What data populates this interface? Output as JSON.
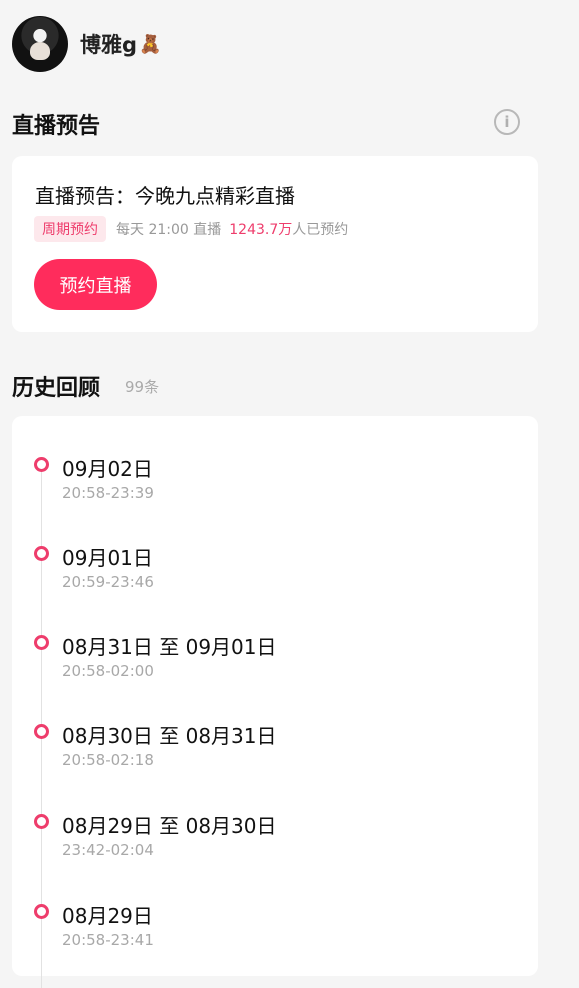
{
  "profile": {
    "username": "博雅g",
    "badge_emoji": "🧸"
  },
  "preview_section": {
    "title": "直播预告",
    "info_icon": "info-icon",
    "card": {
      "title": "直播预告：今晚九点精彩直播",
      "tag": "周期预约",
      "schedule": "每天 21:00 直播",
      "count": "1243.7万",
      "count_suffix": "人已预约",
      "button_label": "预约直播"
    }
  },
  "history_section": {
    "title": "历史回顾",
    "count_label": "99条",
    "items": [
      {
        "date": "09月02日",
        "time": "20:58-23:39"
      },
      {
        "date": "09月01日",
        "time": "20:59-23:46"
      },
      {
        "date": "08月31日 至 09月01日",
        "time": "20:58-02:00"
      },
      {
        "date": "08月30日 至 08月31日",
        "time": "20:58-02:18"
      },
      {
        "date": "08月29日 至 08月30日",
        "time": "23:42-02:04"
      },
      {
        "date": "08月29日",
        "time": "20:58-23:41"
      }
    ]
  },
  "colors": {
    "accent": "#ff2c5c",
    "accent_text": "#ee3d6c",
    "tag_bg": "#fde8ec",
    "background": "#f5f5f5"
  }
}
